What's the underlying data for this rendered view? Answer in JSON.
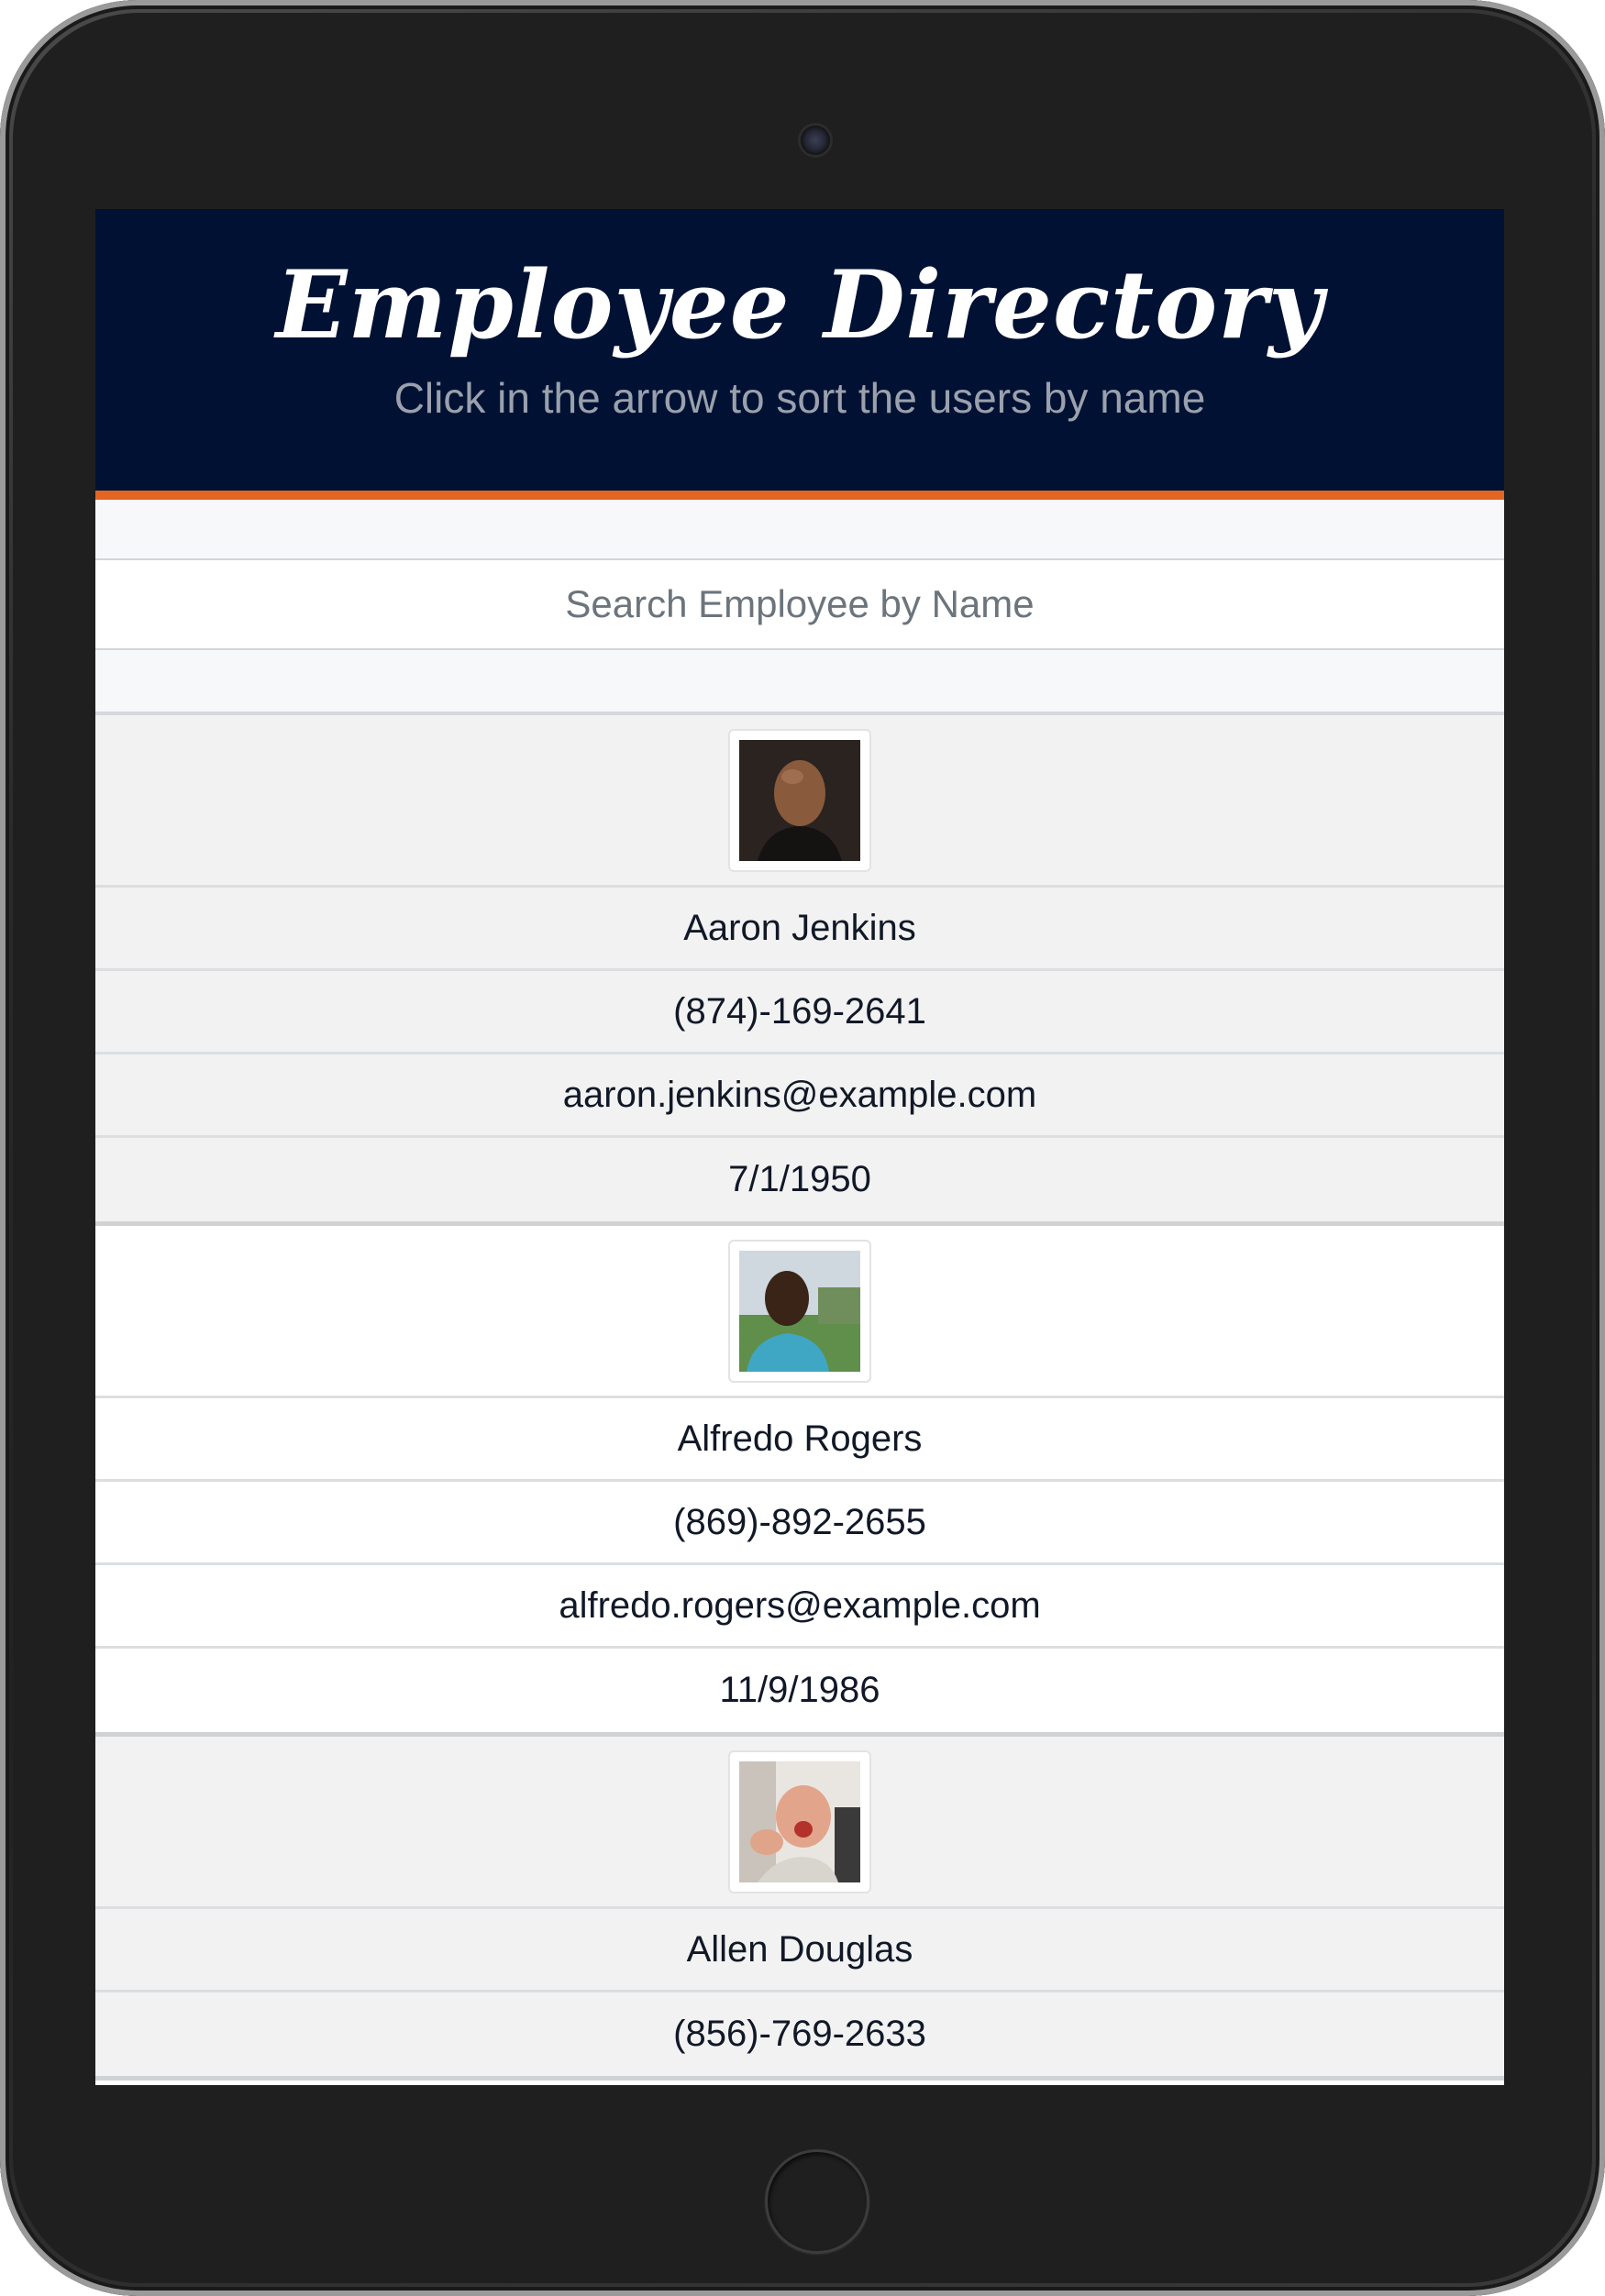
{
  "header": {
    "title": "Employee Directory",
    "subtitle": "Click in the arrow to sort the users by name",
    "background_color": "#011133",
    "accent_color": "#e26522"
  },
  "search": {
    "placeholder": "Search Employee by Name",
    "value": ""
  },
  "employees": [
    {
      "name": "Aaron Jenkins",
      "phone": "(874)-169-2641",
      "email": "aaron.jenkins@example.com",
      "dob": "7/1/1950",
      "avatar": "portrait-photo"
    },
    {
      "name": "Alfredo Rogers",
      "phone": "(869)-892-2655",
      "email": "alfredo.rogers@example.com",
      "dob": "11/9/1986",
      "avatar": "portrait-photo"
    },
    {
      "name": "Allen Douglas",
      "phone": "(856)-769-2633",
      "email": "",
      "dob": "",
      "avatar": "portrait-photo"
    }
  ]
}
